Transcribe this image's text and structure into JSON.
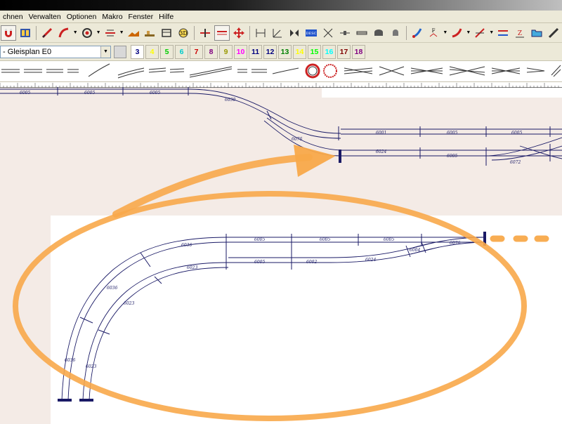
{
  "menu": {
    "items": [
      "chnen",
      "Verwalten",
      "Optionen",
      "Makro",
      "Fenster",
      "Hilfe"
    ]
  },
  "layer_toolbar": {
    "selected_layer": "- Gleisplan E0",
    "numbers": [
      {
        "label": "3",
        "color": "#000080"
      },
      {
        "label": "4",
        "color": "#ffff00"
      },
      {
        "label": "5",
        "color": "#00cc00"
      },
      {
        "label": "6",
        "color": "#00cccc"
      },
      {
        "label": "7",
        "color": "#cc0000"
      },
      {
        "label": "8",
        "color": "#800080"
      },
      {
        "label": "9",
        "color": "#999900"
      },
      {
        "label": "10",
        "color": "#ff00ff"
      },
      {
        "label": "11",
        "color": "#000080"
      },
      {
        "label": "12",
        "color": "#000080"
      },
      {
        "label": "13",
        "color": "#008000"
      },
      {
        "label": "14",
        "color": "#ffff00"
      },
      {
        "label": "15",
        "color": "#00ff00"
      },
      {
        "label": "16",
        "color": "#00ffff"
      },
      {
        "label": "17",
        "color": "#800000"
      },
      {
        "label": "18",
        "color": "#800080"
      }
    ]
  },
  "toolbar_icons": {
    "desc_label": "DESC",
    "z_label": "Z"
  },
  "top_plan": {
    "track_labels": [
      "6005",
      "6005",
      "6005",
      "6030",
      "6076",
      "6001",
      "6005",
      "6005",
      "6024",
      "6005",
      "6072"
    ]
  },
  "zoom_plan": {
    "track_labels": [
      "6036",
      "6005",
      "6005",
      "6005",
      "6004",
      "6076",
      "6023",
      "6005",
      "6002",
      "6024",
      "6036",
      "6023",
      "6036",
      "6023"
    ]
  },
  "colors": {
    "track": "#1a1a66",
    "highlight": "#f8a94a",
    "canvas_bg": "#f4ebe6"
  }
}
